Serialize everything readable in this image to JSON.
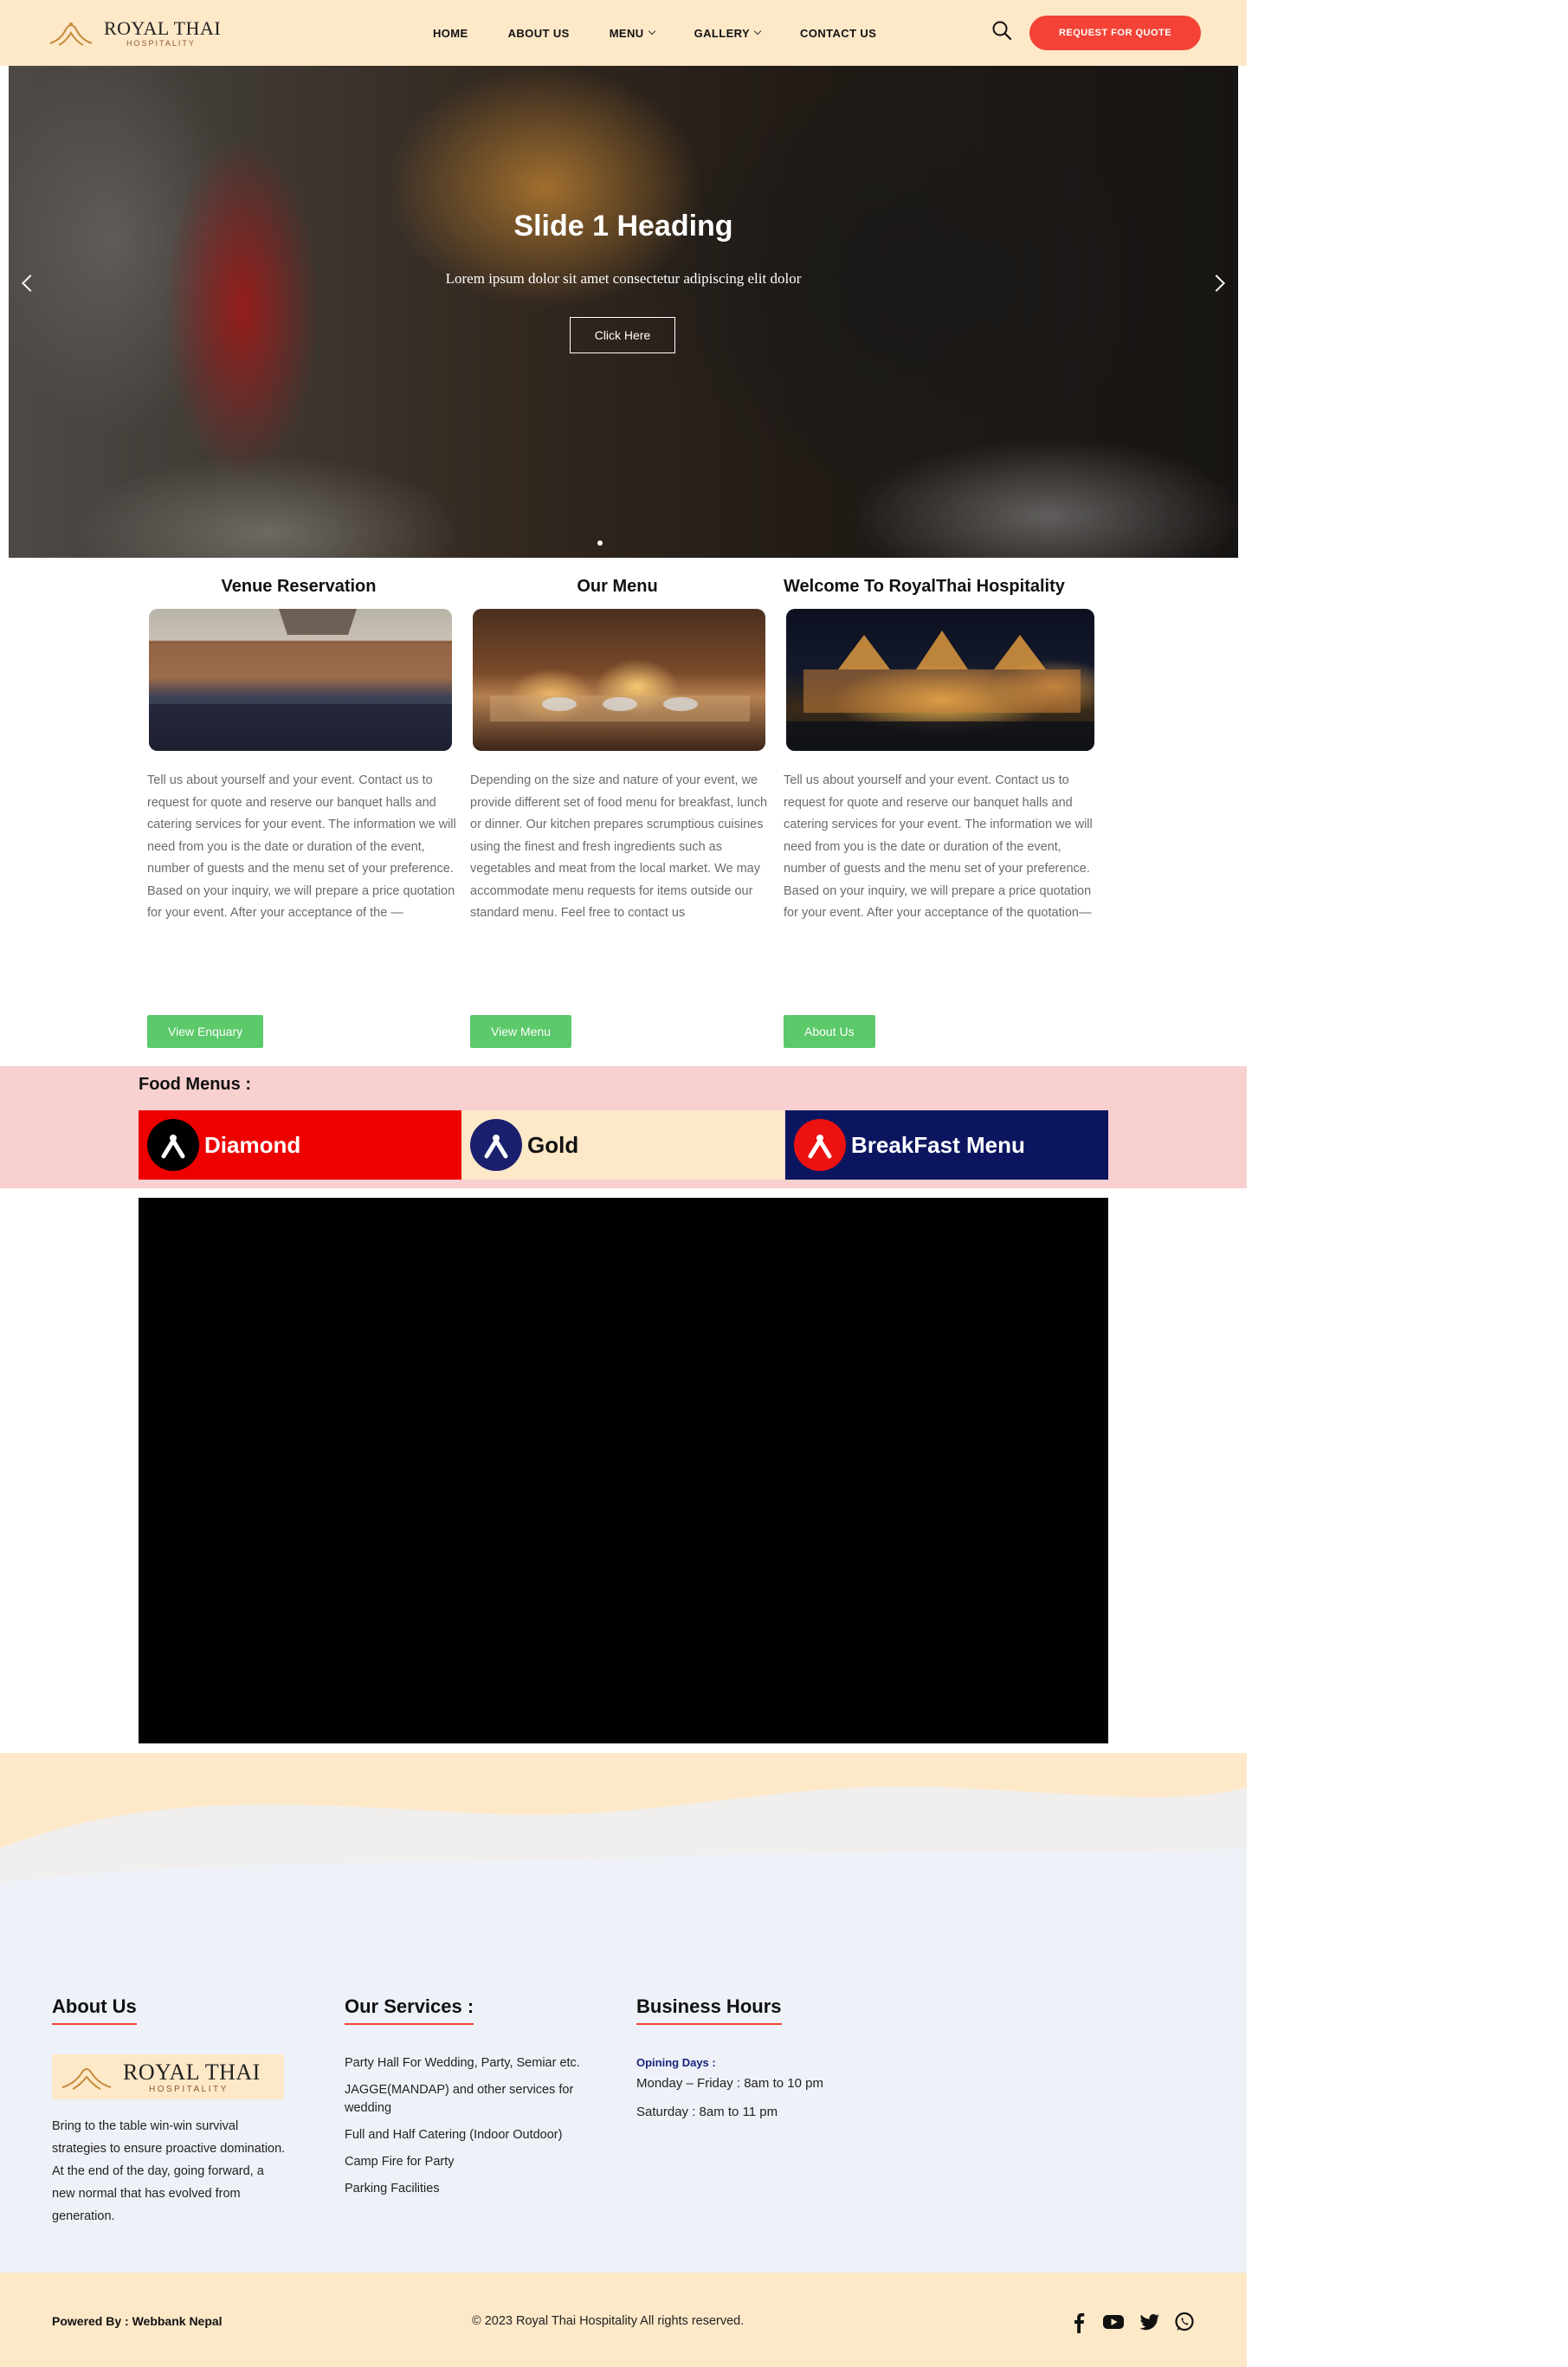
{
  "header": {
    "logo_name": "ROYAL THAI",
    "logo_sub": "HOSPITALITY",
    "nav": [
      {
        "label": "HOME",
        "dropdown": false
      },
      {
        "label": "ABOUT US",
        "dropdown": false
      },
      {
        "label": "MENU",
        "dropdown": true
      },
      {
        "label": "GALLERY",
        "dropdown": true
      },
      {
        "label": "CONTACT US",
        "dropdown": false
      }
    ],
    "search_icon": "search-icon",
    "quote_button": "REQUEST FOR QUOTE",
    "accent_color": "#f44336",
    "bg_color": "#fde8c8"
  },
  "hero": {
    "heading": "Slide 1 Heading",
    "caption": "Lorem ipsum dolor sit amet consectetur adipiscing elit dolor",
    "button": "Click Here"
  },
  "cards": [
    {
      "title": "Venue Reservation",
      "text": "Tell us about yourself and your event. Contact us to request for quote and reserve our banquet halls and catering services for your event. The information we will need from you is the date or duration of the event, number of guests and the menu set of your preference. Based on your inquiry, we will prepare a price quotation for your event. After your acceptance of the —",
      "button": "View Enquary"
    },
    {
      "title": "Our Menu",
      "text": "Depending on the size and nature of your event, we provide different set of food menu for breakfast, lunch or dinner.  Our kitchen prepares scrumptious cuisines using the finest and fresh ingredients such as vegetables and meat from the local market.  We may accommodate menu requests for items outside our standard menu. Feel free to contact us",
      "button": "View Menu"
    },
    {
      "title": "Welcome To RoyalThai Hospitality",
      "text": "Tell us about yourself and your event. Contact us to request for quote and reserve our banquet halls and catering services for your event. The information we will need from you is the date or duration of the event, number of guests and the menu set of your preference. Based on your inquiry, we will prepare a price quotation for your event. After your acceptance of the quotation—",
      "button": "About Us"
    }
  ],
  "food_menus": {
    "label": "Food Menus :",
    "tiles": [
      {
        "label": "Diamond",
        "bg": "#ee0000",
        "text_color": "#ffffff",
        "badge_bg": "#000000"
      },
      {
        "label": "Gold",
        "bg": "#fde8c8",
        "text_color": "#111111",
        "badge_bg": "#1a1f6e"
      },
      {
        "label": "BreakFast Menu",
        "bg": "#0c1560",
        "text_color": "#ffffff",
        "badge_bg": "#ee1111"
      }
    ]
  },
  "footer": {
    "about_title": "About Us",
    "about_logo_name": "ROYAL THAI",
    "about_logo_sub": "HOSPITALITY",
    "about_text": "Bring to the table win-win survival strategies to ensure proactive domination. At the end of the day, going forward, a new normal that has evolved from generation.",
    "services_title": "Our Services :",
    "services": [
      "Party Hall For Wedding, Party, Semiar etc.",
      "JAGGE(MANDAP) and other services for wedding",
      "Full and Half Catering (Indoor Outdoor)",
      "Camp Fire for Party",
      "Parking Facilities"
    ],
    "hours_title": "Business Hours",
    "opening_label": "Opining Days :",
    "hours": [
      "Monday – Friday :  8am to 10 pm",
      "Saturday :   8am to 11 pm"
    ]
  },
  "bottom_bar": {
    "powered": "Powered By : Webbank Nepal",
    "copyright": "© 2023 Royal Thai Hospitality All rights reserved.",
    "social": [
      "facebook-icon",
      "youtube-icon",
      "twitter-icon",
      "whatsapp-icon"
    ]
  }
}
